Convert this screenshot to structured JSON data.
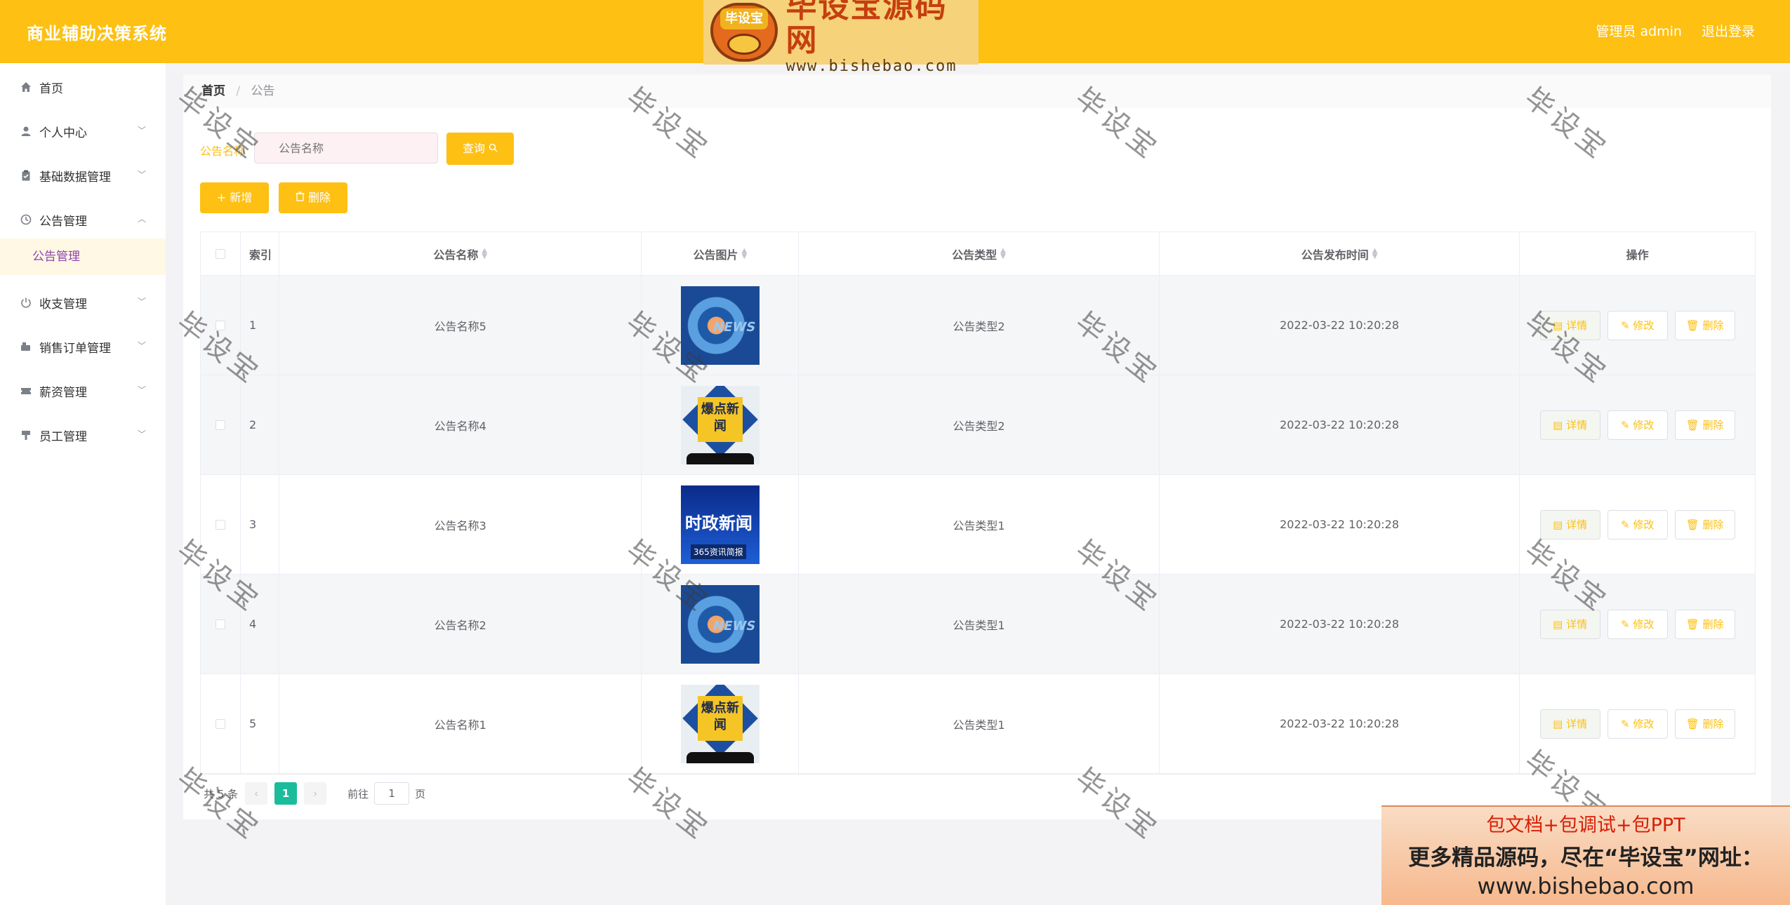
{
  "header": {
    "app_title": "商业辅助决策系统",
    "user_label": "管理员 admin",
    "logout_label": "退出登录"
  },
  "watermark": {
    "logo_badge": "毕设宝",
    "logo_title": "毕设宝源码网",
    "logo_url": "www.bishebao.com",
    "overlay_text": "毕设宝"
  },
  "sidebar": {
    "items": [
      {
        "label": "首页",
        "icon": "home-icon"
      },
      {
        "label": "个人中心",
        "icon": "user-icon"
      },
      {
        "label": "基础数据管理",
        "icon": "clipboard-icon"
      },
      {
        "label": "公告管理",
        "icon": "clock-icon"
      },
      {
        "label": "收支管理",
        "icon": "power-icon"
      },
      {
        "label": "销售订单管理",
        "icon": "cart-icon"
      },
      {
        "label": "薪资管理",
        "icon": "ticket-icon"
      },
      {
        "label": "员工管理",
        "icon": "stamp-icon"
      }
    ],
    "submenu_active": "公告管理"
  },
  "breadcrumb": {
    "home": "首页",
    "separator": "/",
    "current": "公告"
  },
  "search": {
    "label": "公告名称",
    "placeholder": "公告名称",
    "query_button": "查询"
  },
  "actions": {
    "add_label": "新增",
    "delete_label": "删除"
  },
  "table": {
    "headers": {
      "index": "索引",
      "name": "公告名称",
      "image": "公告图片",
      "type": "公告类型",
      "time": "公告发布时间",
      "ops": "操作"
    },
    "rows": [
      {
        "index": "1",
        "name": "公告名称5",
        "image": "news",
        "type": "公告类型2",
        "time": "2022-03-22 10:20:28"
      },
      {
        "index": "2",
        "name": "公告名称4",
        "image": "boom",
        "type": "公告类型2",
        "time": "2022-03-22 10:20:28"
      },
      {
        "index": "3",
        "name": "公告名称3",
        "image": "politics",
        "type": "公告类型1",
        "time": "2022-03-22 10:20:28"
      },
      {
        "index": "4",
        "name": "公告名称2",
        "image": "news",
        "type": "公告类型1",
        "time": "2022-03-22 10:20:28"
      },
      {
        "index": "5",
        "name": "公告名称1",
        "image": "boom",
        "type": "公告类型1",
        "time": "2022-03-22 10:20:28"
      }
    ],
    "op_labels": {
      "detail": "详情",
      "edit": "修改",
      "delete": "删除"
    },
    "image_text": {
      "news": "NEWS",
      "boom": "爆点新闻",
      "politics": "时政新闻",
      "politics_sub": "365资讯简报"
    }
  },
  "pagination": {
    "total_label": "共 5 条",
    "current_page": "1",
    "goto_label": "前往",
    "goto_value": "1",
    "page_suffix": "页"
  },
  "ad_banner": {
    "line1": "包文档+包调试+包PPT",
    "line2": "更多精品源码，尽在“毕设宝”网址：",
    "line3": "www.bishebao.com"
  },
  "colors": {
    "accent": "#fdc013",
    "page_active": "#1abc9c",
    "submenu_text": "#8e44ad"
  }
}
